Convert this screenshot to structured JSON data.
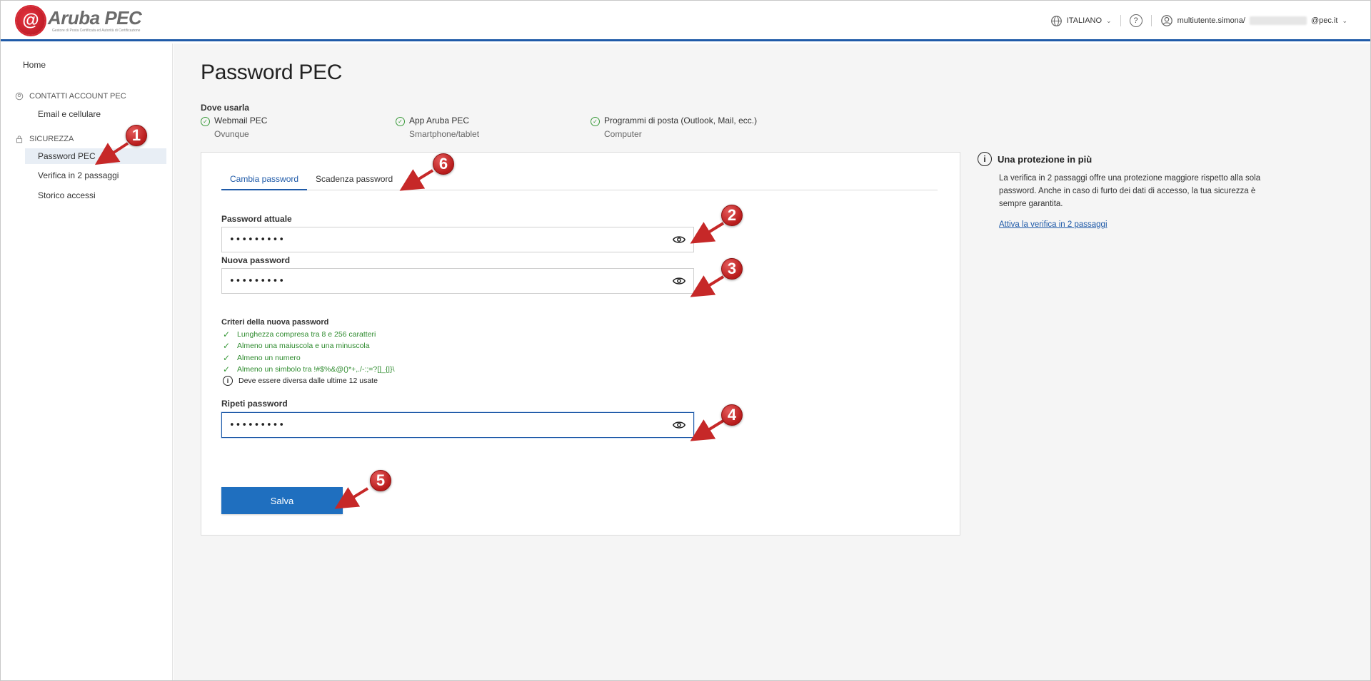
{
  "header": {
    "brand": "Aruba PEC",
    "brand_sub": "Gestore di Posta Certificata ed Autorità di Certificazione",
    "language": "ITALIANO",
    "user_prefix": "multiutente.simona/",
    "user_suffix": "@pec.it"
  },
  "sidebar": {
    "home": "Home",
    "section_contacts": "CONTATTI ACCOUNT PEC",
    "item_email": "Email e cellulare",
    "section_security": "SICUREZZA",
    "item_password": "Password PEC",
    "item_2step": "Verifica in 2 passaggi",
    "item_history": "Storico accessi"
  },
  "main": {
    "title": "Password PEC",
    "where_title": "Dove usarla",
    "where": [
      {
        "title": "Webmail PEC",
        "sub": "Ovunque"
      },
      {
        "title": "App Aruba PEC",
        "sub": "Smartphone/tablet"
      },
      {
        "title": "Programmi di posta (Outlook, Mail, ecc.)",
        "sub": "Computer"
      }
    ]
  },
  "form": {
    "tab_change": "Cambia password",
    "tab_expiry": "Scadenza password",
    "current_label": "Password attuale",
    "current_value": "•••••••••",
    "new_label": "Nuova password",
    "new_value": "•••••••••",
    "criteria_title": "Criteri della nuova password",
    "criteria": [
      "Lunghezza compresa tra 8 e 256 caratteri",
      "Almeno una maiuscola e una minuscola",
      "Almeno un numero",
      "Almeno un simbolo tra !#$%&@()*+,./-:;=?[]_{|}\\"
    ],
    "criteria_info": "Deve essere diversa dalle ultime 12 usate",
    "repeat_label": "Ripeti password",
    "repeat_value": "•••••••••",
    "save": "Salva"
  },
  "info": {
    "title": "Una protezione in più",
    "body": "La verifica in 2 passaggi offre una protezione maggiore rispetto alla sola password. Anche in caso di furto dei dati di accesso, la tua sicurezza è sempre garantita.",
    "link": "Attiva la verifica in 2 passaggi"
  },
  "annotations": [
    "1",
    "2",
    "3",
    "4",
    "5",
    "6"
  ],
  "colors": {
    "accent": "#1f5aa8",
    "button": "#1f6fbf",
    "success": "#2e8b2e",
    "badge": "#c62828"
  }
}
